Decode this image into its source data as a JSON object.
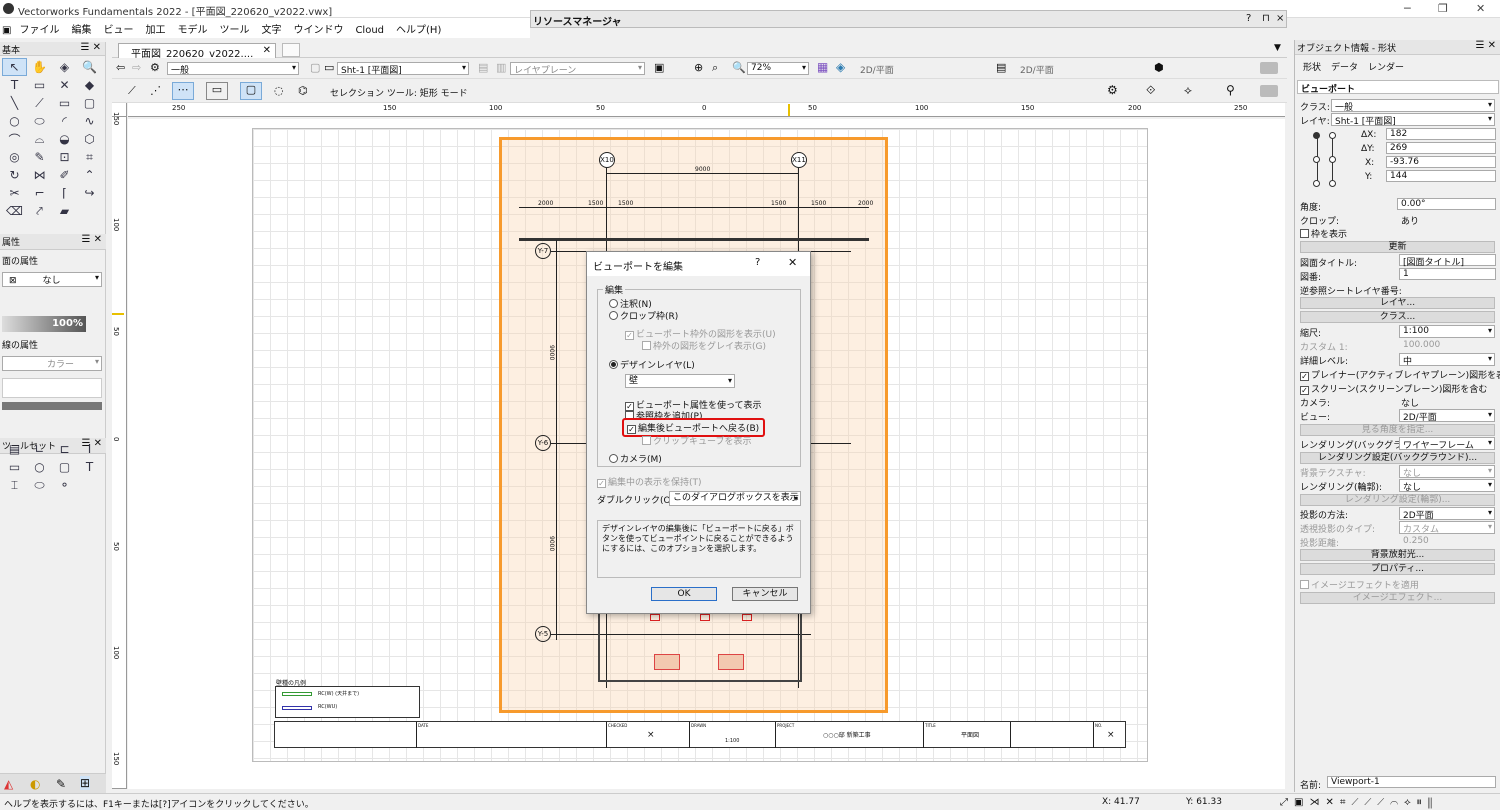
{
  "app": {
    "title": "Vectorworks Fundamentals 2022 - [平面図_220620_v2022.vwx]"
  },
  "menu": [
    "ファイル",
    "編集",
    "ビュー",
    "加工",
    "モデル",
    "ツール",
    "文字",
    "ウインドウ",
    "Cloud",
    "ヘルプ(H)"
  ],
  "resource_manager": {
    "title": "リソースマネージャ",
    "controls": [
      "?",
      "⊓",
      "×"
    ]
  },
  "left": {
    "basic_title": "基本",
    "attr_title": "属性",
    "fill_label": "面の属性",
    "fill_value": "なし",
    "opacity": "100%",
    "line_label": "線の属性",
    "line_value": "カラー",
    "toolset_title": "ツールセット"
  },
  "document": {
    "tab": "平面図_220620_v2022....",
    "class_value": "一般",
    "layer_value": "Sht-1 [平面図]",
    "layer_plane": "レイヤプレーン",
    "zoom": "72%",
    "view_2d": "2D/平面",
    "view_2d_b": "2D/平面",
    "mode_text": "セレクション ツール: 矩形 モード"
  },
  "ruler": [
    "250",
    "200",
    "150",
    "100",
    "50",
    "0",
    "50",
    "100",
    "150",
    "200",
    "250"
  ],
  "ruler_v": [
    "150",
    "100",
    "50",
    "0",
    "50",
    "100",
    "150"
  ],
  "drawing": {
    "legend_title": "壁種の凡例",
    "legend_items": [
      "RC(W) (天井まで)",
      "RC(WU)"
    ],
    "title_block": [
      "DATE",
      "CHECKED",
      "DRAWN",
      "PROJECT",
      "TITLE",
      "NO."
    ],
    "project": "○○○邸 新築工事",
    "drawing_title": "平面図",
    "scale": "1:100",
    "axes": [
      "X10",
      "X11",
      "Y-7",
      "Y-6",
      "Y-5"
    ],
    "dims": [
      "9000",
      "2000",
      "1500",
      "1500",
      "1500",
      "1500",
      "2000",
      "9000",
      "9000"
    ]
  },
  "dialog": {
    "title": "ビューポートを編集",
    "help": "?",
    "close": "✕",
    "group": "編集",
    "options": {
      "annotation": "注釈(N)",
      "crop": "クロップ枠(R)",
      "show_outside": "ビューポート枠外の図形を表示(U)",
      "gray_outside": "枠外の図形をグレイ表示(G)",
      "design_layer": "デザインレイヤ(L)",
      "layer_select": "壁",
      "use_vp_attr": "ビューポート属性を使って表示",
      "add_ref": "参照枠を追加(P)",
      "return_vp": "編集後ビューポートへ戻る(B)",
      "clip_cube": "クリップキューブを表示",
      "camera": "カメラ(M)"
    },
    "keep_display": "編集中の表示を保持(T)",
    "dblclick_label": "ダブルクリック(O)",
    "dblclick_value": "このダイアログボックスを表示",
    "help_text": "デザインレイヤの編集後に「ビューポートに戻る」ボタンを使ってビューポイントに戻ることができるようにするには、このオプションを選択します。",
    "ok": "OK",
    "cancel": "キャンセル"
  },
  "obj_info": {
    "title": "オブジェクト情報 - 形状",
    "tabs": [
      "形状",
      "データ",
      "レンダー"
    ],
    "type": "ビューポート",
    "class_label": "クラス:",
    "class_value": "一般",
    "layer_label": "レイヤ:",
    "layer_value": "Sht-1 [平面図]",
    "dx_label": "ΔX:",
    "dx": "182",
    "dy_label": "ΔY:",
    "dy": "269",
    "x_label": "X:",
    "x": "-93.76",
    "y_label": "Y:",
    "y": "144",
    "angle_label": "角度:",
    "angle": "0.00°",
    "crop_label": "クロップ:",
    "crop": "あり",
    "show_frame": "枠を表示",
    "update": "更新",
    "dtitle_label": "図面タイトル:",
    "dtitle": "[図面タイトル]",
    "dnum_label": "図番:",
    "dnum": "1",
    "backref_label": "逆参照シートレイヤ番号:",
    "layer_btn": "レイヤ...",
    "class_btn": "クラス...",
    "scale_label": "縮尺:",
    "scale": "1:100",
    "custom_label": "カスタム 1:",
    "custom": "100.000",
    "detail_label": "詳細レベル:",
    "detail": "中",
    "planar": "プレイナー(アクティブレイヤプレーン)図形を表示",
    "screen": "スクリーン(スクリーンプレーン)図形を含む",
    "camera_label": "カメラ:",
    "camera": "なし",
    "view_label": "ビュー:",
    "view": "2D/平面",
    "angle_btn": "見る角度を指定...",
    "render_bg_label": "レンダリング(バックグラウ...",
    "render_bg": "ワイヤーフレーム",
    "render_bg_btn": "レンダリング設定(バックグラウンド)...",
    "bg_tex_label": "背景テクスチャ:",
    "bg_tex": "なし",
    "render_line_label": "レンダリング(輪郭):",
    "render_line": "なし",
    "render_line_btn": "レンダリング設定(輪郭)...",
    "proj_label": "投影の方法:",
    "proj": "2D平面",
    "persp_label": "透視投影のタイプ:",
    "persp": "カスタム",
    "dist_label": "投影距離:",
    "dist": "0.250",
    "bgrad": "背景放射光...",
    "props": "プロパティ...",
    "image_fx": "イメージエフェクトを適用",
    "image_fx_btn": "イメージエフェクト...",
    "name_label": "名前:",
    "name": "Viewport-1"
  },
  "status": {
    "help": "ヘルプを表示するには、F1キーまたは[?]アイコンをクリックしてください。",
    "x": "X: 41.77",
    "y": "Y: 61.33"
  },
  "colors": {
    "accent": "#f79a2c",
    "highlight": "#e01010",
    "selection": "#cfe3f7"
  }
}
